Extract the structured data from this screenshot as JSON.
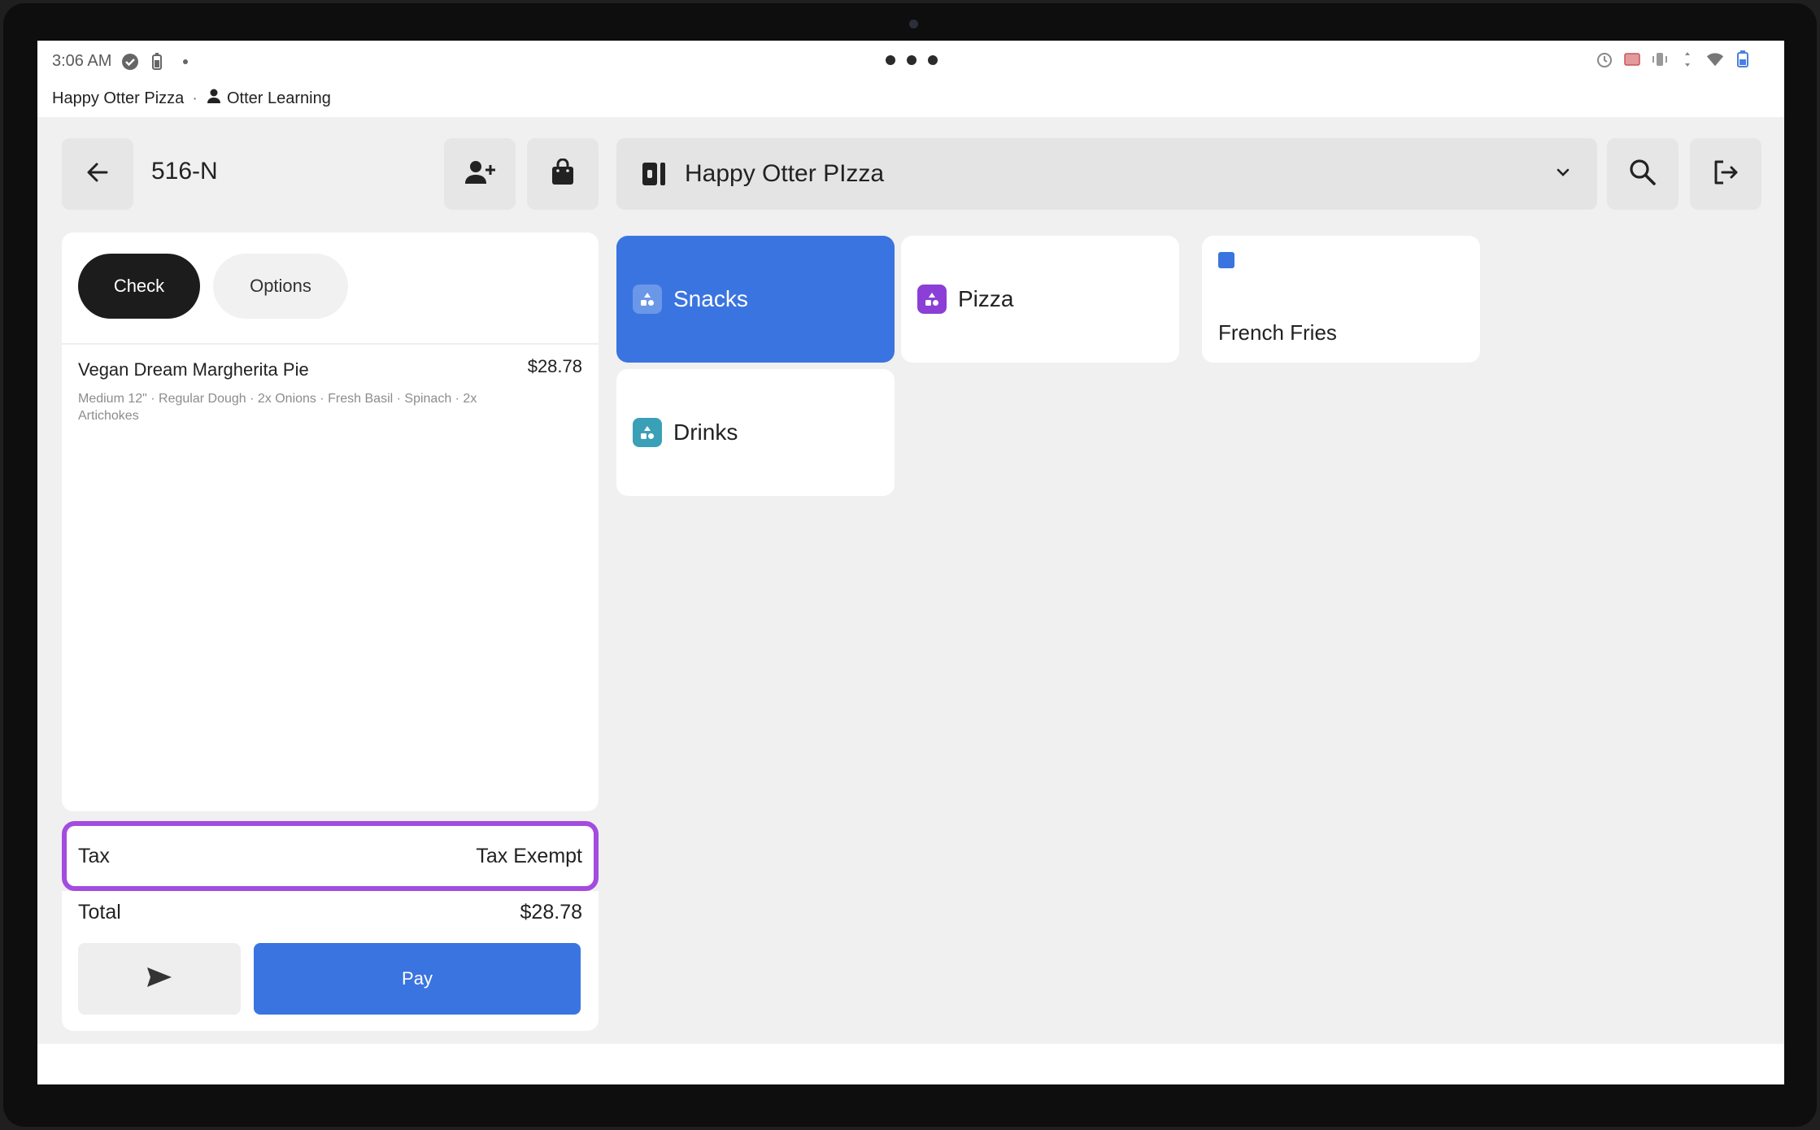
{
  "status_bar": {
    "time": "3:06 AM"
  },
  "account_bar": {
    "store": "Happy Otter Pizza",
    "separator": "·",
    "user": "Otter Learning"
  },
  "order": {
    "id": "516-N"
  },
  "menu_selector": {
    "label": "Happy Otter PIzza"
  },
  "check_tabs": [
    {
      "label": "Check"
    },
    {
      "label": "Options"
    }
  ],
  "line_items": [
    {
      "name": "Vegan Dream Margherita Pie",
      "price": "$28.78",
      "modifiers": "Medium 12\" · Regular Dough · 2x Onions · Fresh Basil · Spinach · 2x Artichokes"
    }
  ],
  "totals": {
    "tax_label": "Tax",
    "tax_value": "Tax Exempt",
    "total_label": "Total",
    "total_value": "$28.78"
  },
  "actions": {
    "pay_label": "Pay"
  },
  "categories": [
    {
      "label": "Snacks",
      "selected": true,
      "icon_color": "#ffffff"
    },
    {
      "label": "Pizza",
      "selected": false,
      "icon_color": "#8b3fd6"
    },
    {
      "label": "French Fries",
      "selected": false,
      "icon_color": "#3a74e0"
    },
    {
      "label": "Drinks",
      "selected": false,
      "icon_color": "#3aa0b8"
    }
  ],
  "colors": {
    "accent": "#3a74e0",
    "highlight": "#a44be0"
  }
}
